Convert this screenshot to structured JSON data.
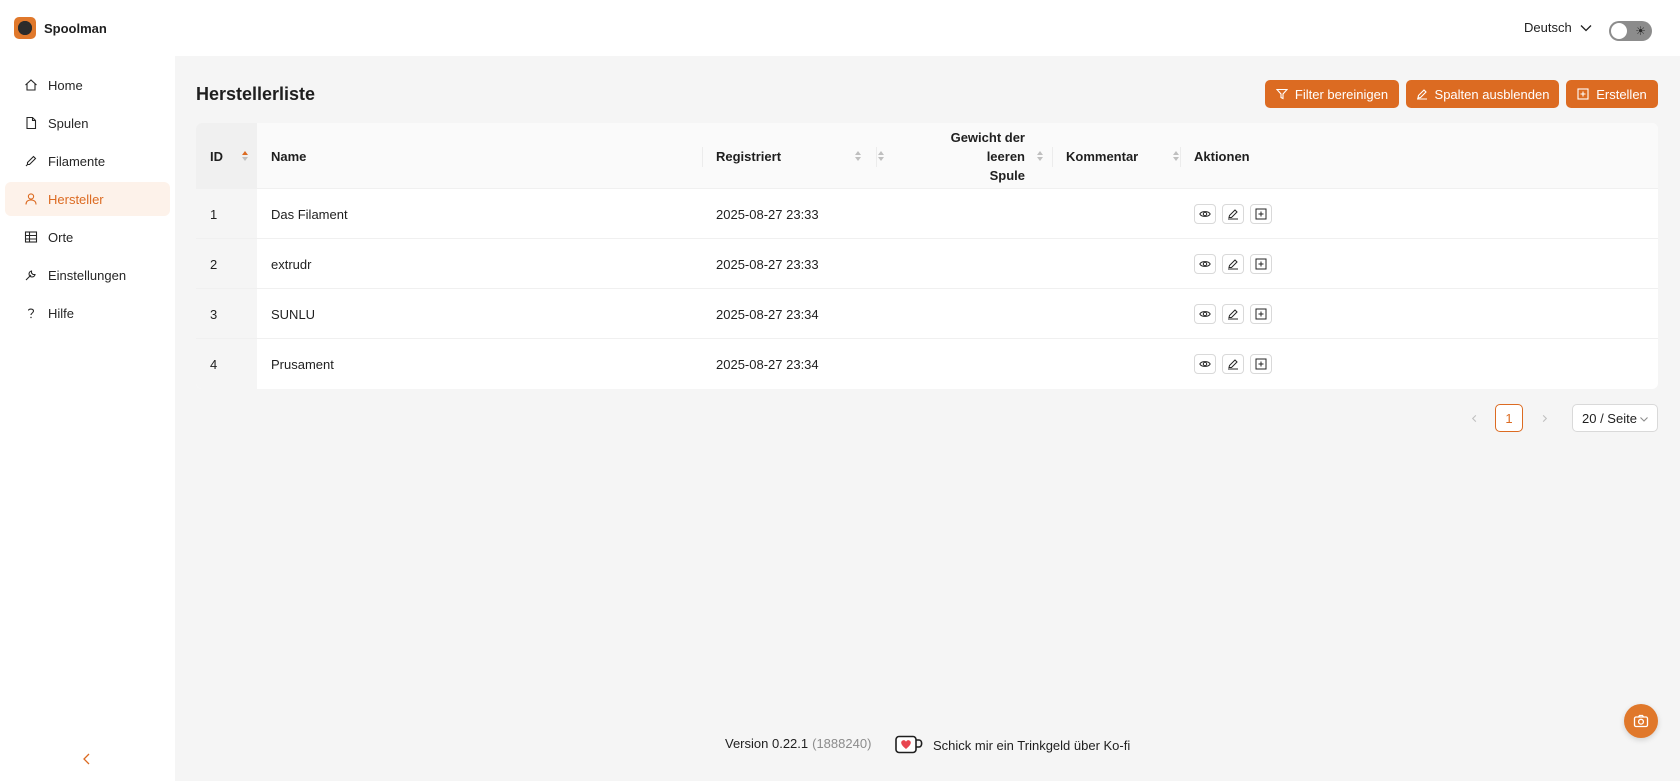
{
  "app": {
    "name": "Spoolman"
  },
  "header": {
    "language": "Deutsch",
    "theme_toggle_icon": "sun-icon"
  },
  "sidebar": {
    "items": [
      {
        "label": "Home",
        "icon": "home-icon",
        "active": false
      },
      {
        "label": "Spulen",
        "icon": "file-icon",
        "active": false
      },
      {
        "label": "Filamente",
        "icon": "highlighter-icon",
        "active": false
      },
      {
        "label": "Hersteller",
        "icon": "user-icon",
        "active": true
      },
      {
        "label": "Orte",
        "icon": "table-icon",
        "active": false
      },
      {
        "label": "Einstellungen",
        "icon": "wrench-icon",
        "active": false
      },
      {
        "label": "Hilfe",
        "icon": "question-icon",
        "active": false
      }
    ],
    "collapse_icon": "chevron-left-icon"
  },
  "page": {
    "title": "Herstellerliste",
    "buttons": {
      "clear_filters": "Filter bereinigen",
      "hide_columns": "Spalten ausblenden",
      "create": "Erstellen"
    }
  },
  "table": {
    "columns": {
      "id": "ID",
      "name": "Name",
      "registered": "Registriert",
      "weight_line1": "Gewicht der leeren",
      "weight_line2": "Spule",
      "comment": "Kommentar",
      "actions": "Aktionen"
    },
    "rows": [
      {
        "id": "1",
        "name": "Das Filament",
        "registered": "2025-08-27 23:33",
        "weight": "",
        "comment": ""
      },
      {
        "id": "2",
        "name": "extrudr",
        "registered": "2025-08-27 23:33",
        "weight": "",
        "comment": ""
      },
      {
        "id": "3",
        "name": "SUNLU",
        "registered": "2025-08-27 23:34",
        "weight": "",
        "comment": ""
      },
      {
        "id": "4",
        "name": "Prusament",
        "registered": "2025-08-27 23:34",
        "weight": "",
        "comment": ""
      }
    ]
  },
  "pagination": {
    "current_page": "1",
    "page_size": "20 / Seite"
  },
  "footer": {
    "version": "Version 0.22.1",
    "commit": "(1888240)",
    "kofi": "Schick mir ein Trinkgeld über Ko-fi"
  },
  "colors": {
    "accent": "#dc6b22",
    "active_bg": "#fdf2ea"
  }
}
